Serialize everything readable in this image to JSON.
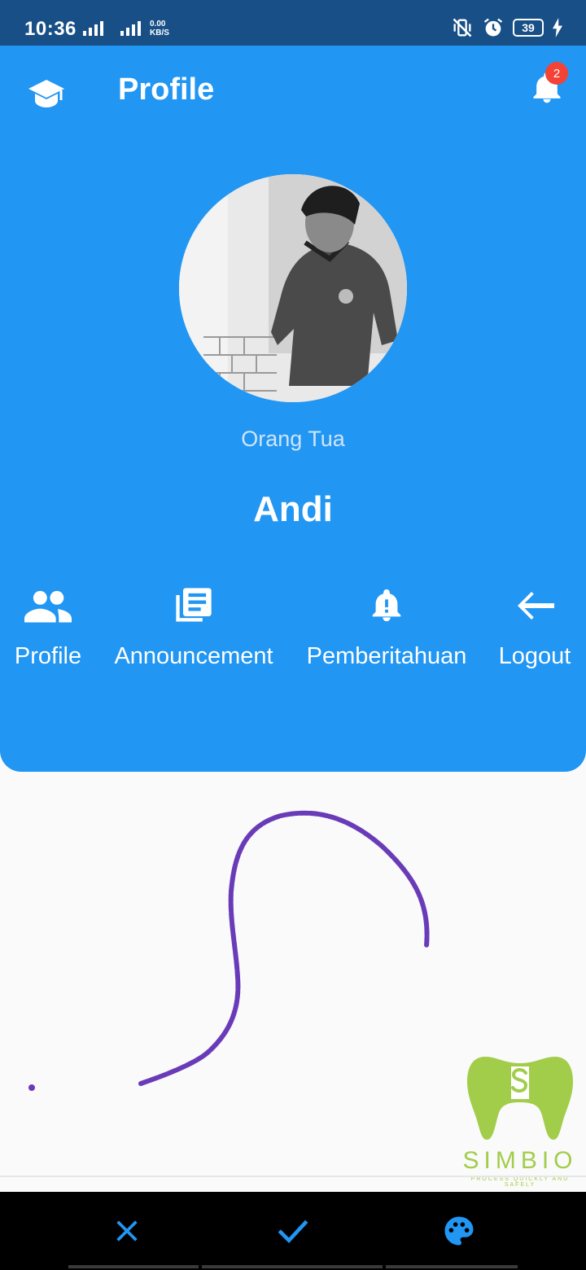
{
  "status_bar": {
    "time": "10:36",
    "net_speed_value": "0.00",
    "net_speed_unit": "KB/S",
    "battery": "39"
  },
  "header": {
    "title": "Profile",
    "notification_count": "2"
  },
  "profile": {
    "role": "Orang Tua",
    "name": "Andi"
  },
  "menu": [
    {
      "label": "Profile",
      "icon": "people-icon"
    },
    {
      "label": "Announcement",
      "icon": "newspaper-icon"
    },
    {
      "label": "Pemberitahuan",
      "icon": "alert-bell-icon"
    },
    {
      "label": "Logout",
      "icon": "arrow-left-icon"
    }
  ],
  "logo": {
    "name": "SIMBIO",
    "tagline": "PROCESS QUICKLY AND SAFELY"
  },
  "bottom_actions": [
    {
      "icon": "close-icon"
    },
    {
      "icon": "check-icon"
    },
    {
      "icon": "palette-icon"
    }
  ],
  "colors": {
    "primary": "#2196f3",
    "status_bar": "#174f86",
    "badge": "#f44336",
    "stroke": "#6a3bb8",
    "logo": "#a2cd4a"
  }
}
